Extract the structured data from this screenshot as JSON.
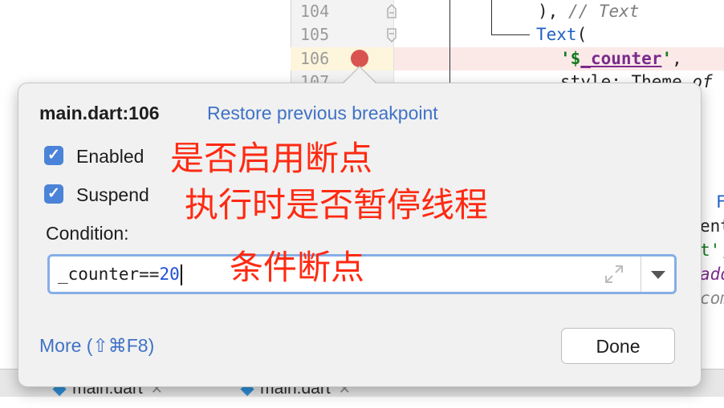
{
  "editor": {
    "line_numbers": [
      "104",
      "105",
      "106",
      "107"
    ],
    "code_lines": {
      "l104_a": "), ",
      "l104_b": "// Text",
      "l105_type": "Text",
      "l105_b": "(",
      "l106_str_open": "'",
      "l106_dollar": "$",
      "l106_var": "_counter",
      "l106_str_close": "'",
      "l106_end": ",",
      "l107_a": "style: Theme.",
      "l107_b": "of",
      "r1": "F",
      "r2": "ent",
      "r3": "t',",
      "r4": "add",
      "r5": "com"
    },
    "breakpoint_color": "#d9534f",
    "bottom_tabs": [
      {
        "label": "main.dart"
      },
      {
        "label": "main.dart"
      }
    ]
  },
  "popup": {
    "title": "main.dart:106",
    "restore_link": "Restore previous breakpoint",
    "enabled_label": "Enabled",
    "enabled_checked": true,
    "suspend_label": "Suspend",
    "suspend_checked": true,
    "condition_label": "Condition:",
    "condition_text": "_counter==",
    "condition_number": "20",
    "more_link": "More (⇧⌘F8)",
    "done_label": "Done"
  },
  "annotations": {
    "enabled_note": "是否启用断点",
    "suspend_note": "执行时是否暂停线程",
    "condition_note": "条件断点"
  },
  "colors": {
    "link": "#3f72c6",
    "checkbox": "#4a83d8",
    "annotation": "#ff2a12",
    "focus_border": "#86aee6"
  }
}
